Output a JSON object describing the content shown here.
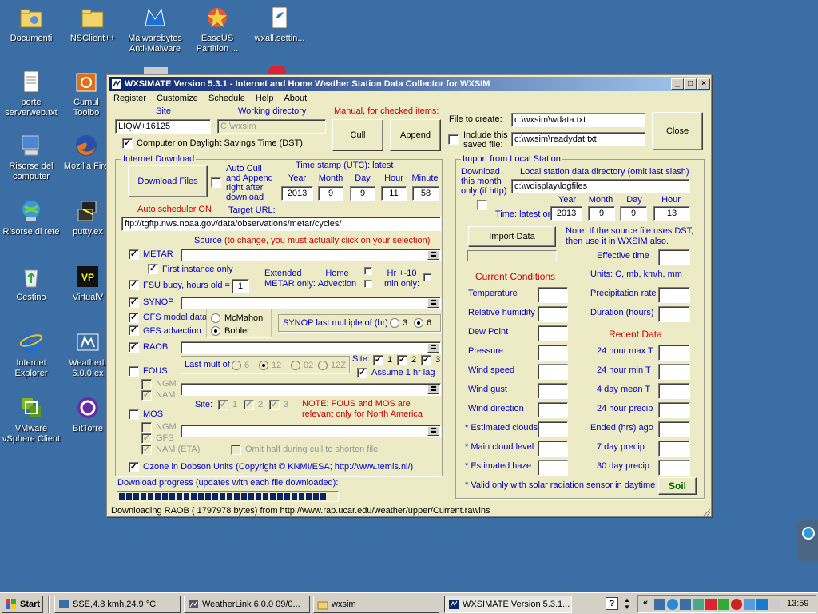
{
  "desktop": {
    "icons": [
      {
        "label": "Documenti"
      },
      {
        "label": "NSClient++"
      },
      {
        "label": "Malwarebytes Anti-Malware"
      },
      {
        "label": "EaseUS Partition ..."
      },
      {
        "label": "wxall.settin..."
      },
      {
        "label": "porte serverweb.txt"
      },
      {
        "label": "Cumul Toolbo"
      },
      {
        "label": "Risorse del computer"
      },
      {
        "label": "Mozilla Fire"
      },
      {
        "label": "Risorse di rete"
      },
      {
        "label": "putty.ex"
      },
      {
        "label": "Cestino"
      },
      {
        "label": "VirtualV"
      },
      {
        "label": "Internet Explorer"
      },
      {
        "label": "WeatherL 6.0.0.ex"
      },
      {
        "label": "VMware vSphere Client"
      },
      {
        "label": "BitTorre"
      }
    ]
  },
  "window": {
    "title": "WXSIMATE Version 5.3.1  -  Internet and Home Weather Station Data Collector for WXSIM",
    "menu": [
      "Register",
      "Customize",
      "Schedule",
      "Help",
      "About"
    ],
    "site_label": "Site",
    "site_value": "LIQW+16125",
    "working_dir_label": "Working directory",
    "working_dir_value": "C:\\wxsim",
    "manual_label": "Manual, for checked items:",
    "cull_button": "Cull",
    "append_button": "Append",
    "file_to_create_label": "File to create:",
    "file_to_create_value": "c:\\wxsim\\wdata.txt",
    "include_saved_label": "Include this saved file:",
    "include_saved_value": "c:\\wxsim\\readydat.txt",
    "close_button": "Close",
    "dst_label": "Computer on Daylight Savings Time (DST)",
    "internet_download": {
      "group_title": "Internet Download",
      "download_button": "Download Files",
      "auto_cull_label": "Auto Cull and Append right after download",
      "timestamp_label": "Time stamp (UTC): latest",
      "year_label": "Year",
      "month_label": "Month",
      "day_label": "Day",
      "hour_label": "Hour",
      "minute_label": "Minute",
      "year": "2013",
      "month": "9",
      "day": "9",
      "hour": "11",
      "minute": "58",
      "auto_scheduler": "Auto scheduler ON",
      "target_url_label": "Target URL:",
      "target_url": "ftp://tgftp.nws.noaa.gov/data/observations/metar/cycles/",
      "source_label": "Source",
      "source_note": "(to change,  you must actually click on your selection)",
      "metar_label": "METAR",
      "first_instance_label": "First instance only",
      "extended_metar_label": "Extended METAR only:",
      "home_advection_label": "Home Advection",
      "hr_label": "Hr +-10 min only:",
      "fsu_label": "FSU buoy, hours old =",
      "fsu_value": "1",
      "synop_label": "SYNOP",
      "gfs_model_label": "GFS model data",
      "gfs_advection_label": "GFS advection",
      "mcmahon_label": "McMahon",
      "bohler_label": "Bohler",
      "synop_last_label": "SYNOP last multiple of (hr)",
      "synop_opt3": "3",
      "synop_opt6": "6",
      "raob_label": "RAOB",
      "site_label": "Site:",
      "raob_site1": "1",
      "raob_site2": "2",
      "raob_site3": "3",
      "assume_lag_label": "Assume 1 hr lag",
      "fous_label": "FOUS",
      "last_mult_label": "Last mult of",
      "fous_opt6": "6",
      "fous_opt12": "12",
      "fous_opt02": "02",
      "fous_opt12z": "12Z",
      "ngm_label": "NGM",
      "nam_label": "NAM",
      "fous_site_label": "Site:",
      "fous_site1": "1",
      "fous_site2": "2",
      "fous_site3": "3",
      "fous_note": "NOTE: FOUS and MOS are relevant only for North America",
      "mos_label": "MOS",
      "mos_ngm": "NGM",
      "mos_gfs": "GFS",
      "mos_nam": "NAM (ETA)",
      "omit_half_label": "Omit half during cull to shorten file",
      "ozone_label": "Ozone  in Dobson Units (Copyright © KNMI/ESA; http://www.temis.nl/)"
    },
    "progress_label": "Download progress (updates with each file downloaded):",
    "progress_fraction": 0.98,
    "status_text": "Downloading RAOB ( 1797978 bytes) from http://www.rap.ucar.edu/weather/upper/Current.rawins",
    "local": {
      "group_title": "Import from Local Station",
      "download_month_label": "Download this month only (if http)",
      "local_dir_label": "Local station data directory (omit last slash)",
      "local_dir_value": "c:\\wdisplay\\logfiles",
      "year_label": "Year",
      "month_label": "Month",
      "day_label": "Day",
      "hour_label": "Hour",
      "time_latest_label": "Time: latest or",
      "year": "2013",
      "month": "9",
      "day": "9",
      "hour": "13",
      "import_button": "Import Data",
      "note": "Note: If the source file uses DST, then use it in WXSIM also.",
      "effective_time_label": "Effective  time",
      "current_conditions_title": "Current Conditions",
      "units_label": "Units:  C,  mb,    km/h, mm",
      "cc_items": [
        "Temperature",
        "Relative humidity",
        "Dew Point",
        "Pressure",
        "Wind speed",
        "Wind gust",
        "Wind direction",
        "* Estimated clouds",
        "* Main cloud level",
        "* Estimated haze"
      ],
      "right_items": [
        "Precipitation rate",
        "Duration (hours)"
      ],
      "recent_data_title": "Recent Data",
      "recent_items": [
        "24 hour max T",
        "24 hour min T",
        "4 day mean T",
        "24 hour precip",
        "Ended (hrs) ago",
        "7 day precip",
        "30 day precip"
      ],
      "footnote": "* Valid only with  solar radiation sensor in daytime",
      "soil_button": "Soil"
    }
  },
  "taskbar": {
    "start": "Start",
    "tasks": [
      "SSE,4.8 kmh,24.9 °C",
      "WeatherLink 6.0.0  09/0...",
      "wxsim",
      "WXSIMATE Version 5.3.1..."
    ],
    "clock": "13:59"
  }
}
